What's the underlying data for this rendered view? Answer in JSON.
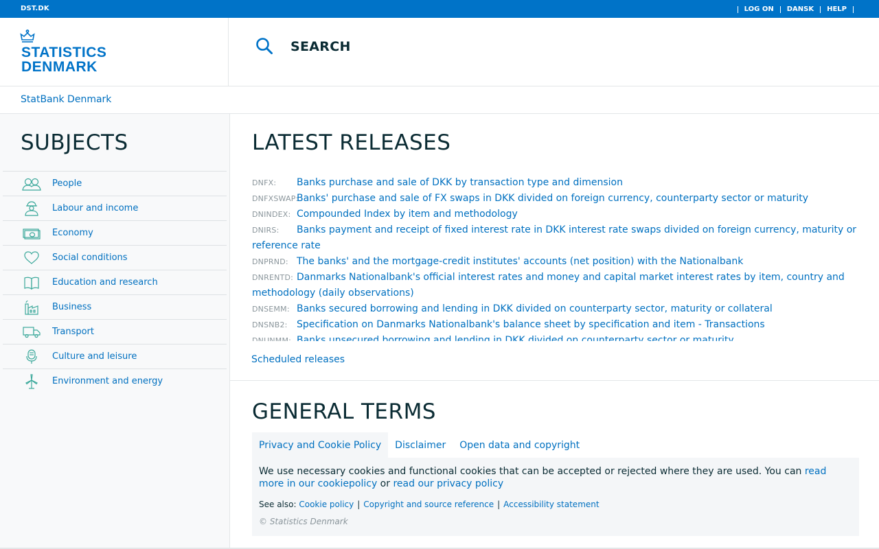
{
  "topbar": {
    "site": "DST.DK",
    "nav": [
      "LOG ON",
      "DANSK",
      "HELP"
    ]
  },
  "logo": {
    "line1": "STATISTICS",
    "line2": "DENMARK"
  },
  "search": {
    "label": "SEARCH"
  },
  "breadcrumb": {
    "label": "StatBank Denmark"
  },
  "sidebar": {
    "title": "SUBJECTS",
    "items": [
      {
        "label": "People",
        "icon": "people-icon"
      },
      {
        "label": "Labour and income",
        "icon": "worker-icon"
      },
      {
        "label": "Economy",
        "icon": "money-icon"
      },
      {
        "label": "Social conditions",
        "icon": "heart-icon"
      },
      {
        "label": "Education and research",
        "icon": "book-icon"
      },
      {
        "label": "Business",
        "icon": "factory-icon"
      },
      {
        "label": "Transport",
        "icon": "truck-icon"
      },
      {
        "label": "Culture and leisure",
        "icon": "microphone-icon"
      },
      {
        "label": "Environment and energy",
        "icon": "windmill-icon"
      }
    ]
  },
  "releases": {
    "title": "LATEST RELEASES",
    "items": [
      {
        "code": "DNFX:",
        "text": "Banks purchase and sale of DKK by transaction type and dimension"
      },
      {
        "code": "DNFXSWAP:",
        "text": "Banks' purchase and sale of FX swaps in DKK divided on foreign currency, counterparty sector or maturity"
      },
      {
        "code": "DNINDEX:",
        "text": "Compounded Index by item and methodology"
      },
      {
        "code": "DNIRS:",
        "text": "Banks payment and receipt of fixed interest rate in DKK interest rate swaps divided on foreign currency, maturity or reference rate"
      },
      {
        "code": "DNPRND:",
        "text": "The banks' and the mortgage-credit institutes' accounts (net position) with the Nationalbank"
      },
      {
        "code": "DNRENTD:",
        "text": "Danmarks Nationalbank's official interest rates and money and capital market interest rates by item, country and methodology (daily observations)"
      },
      {
        "code": "DNSEMM:",
        "text": "Banks secured borrowing and lending in DKK divided on counterparty sector, maturity or collateral"
      },
      {
        "code": "DNSNB2:",
        "text": "Specification on Danmarks Nationalbank's balance sheet by specification and item - Transactions"
      },
      {
        "code": "DNUNMM:",
        "text": "Banks unsecured borrowing and lending in DKK divided on counterparty sector or maturity"
      }
    ],
    "scheduled": "Scheduled releases"
  },
  "terms": {
    "title": "GENERAL TERMS",
    "tabs": [
      "Privacy and Cookie Policy",
      "Disclaimer",
      "Open data and copyright"
    ],
    "text": "We use necessary cookies and functional cookies that can be accepted or rejected where they are used. You can ",
    "link1": "read more in our cookiepolicy",
    "or": " or ",
    "link2": "read our privacy policy",
    "see_also": "See also:",
    "links": [
      "Cookie policy",
      "Copyright and source reference",
      "Accessibility statement"
    ],
    "separator": "|",
    "copyright": "© Statistics Denmark"
  }
}
